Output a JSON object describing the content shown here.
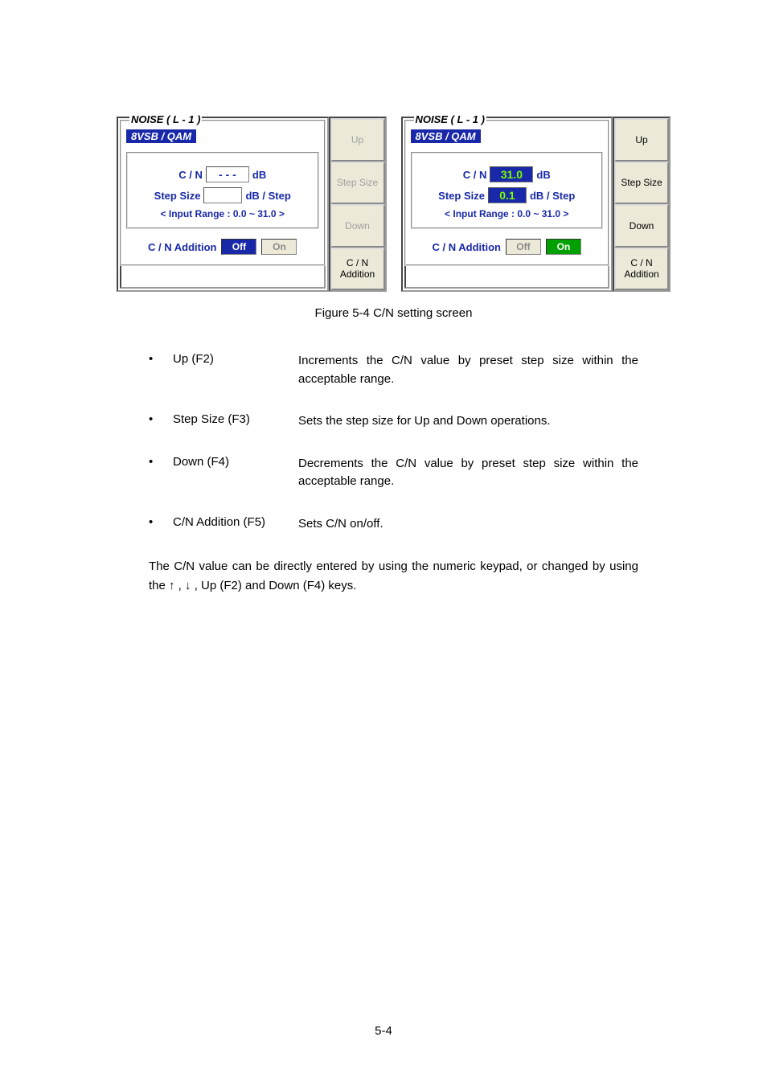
{
  "left": {
    "group_title": "NOISE ( L - 1 )",
    "mode": "8VSB / QAM",
    "cn_label": "C / N",
    "cn_value": "- - -",
    "cn_unit": "dB",
    "step_label": "Step Size",
    "step_value": "",
    "step_unit": "dB / Step",
    "range": "< Input Range : 0.0 ~ 31.0 >",
    "addition_label": "C / N Addition",
    "off": "Off",
    "on": "On",
    "buttons": {
      "up": "Up",
      "step": "Step Size",
      "down": "Down",
      "cn": "C / N\nAddition"
    }
  },
  "right": {
    "group_title": "NOISE ( L - 1 )",
    "mode": "8VSB / QAM",
    "cn_label": "C / N",
    "cn_value": "31.0",
    "cn_unit": "dB",
    "step_label": "Step Size",
    "step_value": "0.1",
    "step_unit": "dB / Step",
    "range": "< Input Range : 0.0 ~ 31.0 >",
    "addition_label": "C / N Addition",
    "off": "Off",
    "on": "On",
    "buttons": {
      "up": "Up",
      "step": "Step Size",
      "down": "Down",
      "cn": "C / N\nAddition"
    }
  },
  "caption": "Figure 5-4    C/N setting screen",
  "bullets": [
    {
      "label": "Up (F2)",
      "desc": "Increments the C/N value by preset step size within the acceptable range."
    },
    {
      "label": "Step Size (F3)",
      "desc": "Sets the step size for Up and Down operations."
    },
    {
      "label": "Down (F4)",
      "desc": "Decrements the C/N value by preset step size within the acceptable range."
    },
    {
      "label": "C/N Addition (F5)",
      "desc": "Sets C/N on/off."
    }
  ],
  "paragraph": "The C/N value can be directly entered by using the numeric keypad, or changed by using the ↑ , ↓ , Up (F2) and Down (F4) keys.",
  "page_number": "5-4"
}
